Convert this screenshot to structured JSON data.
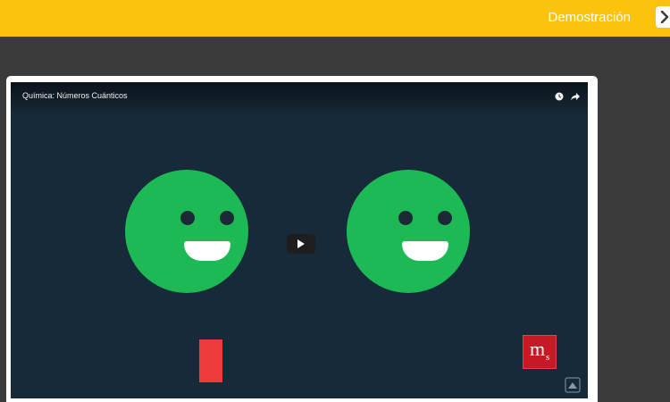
{
  "topbar": {
    "title": "Demostración",
    "background": "#fcc30c",
    "close_icon": "chevron-right-icon"
  },
  "video": {
    "title": "Química: Números Cuánticos",
    "background": "#172a3a",
    "controls": [
      "clock-icon",
      "share-icon"
    ],
    "play_icon": "play-icon",
    "faces_color": "#1db954",
    "accent_red": "#ef3b3b",
    "brand_logo": {
      "main": "m",
      "sub": "s",
      "color": "#c51a24"
    }
  }
}
